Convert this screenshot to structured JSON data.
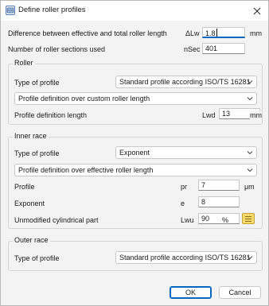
{
  "window": {
    "title": "Define roller profiles"
  },
  "general": {
    "diff_label": "Difference between effective and total roller length",
    "diff_symbol": "ΔLw",
    "diff_value": "1.8",
    "diff_unit": "mm",
    "nsec_label": "Number of roller sections used",
    "nsec_symbol": "nSec",
    "nsec_value": "401"
  },
  "roller": {
    "group_title": "Roller",
    "type_label": "Type of profile",
    "type_value": "Standard profile according ISO/TS 16281",
    "definition_value": "Profile definition over custom roller length",
    "length_label": "Profile definition length",
    "length_symbol": "Lwd",
    "length_value": "13",
    "length_unit": "mm"
  },
  "inner": {
    "group_title": "Inner race",
    "type_label": "Type of profile",
    "type_value": "Exponent",
    "definition_value": "Profile definition over effective roller length",
    "profile_label": "Profile",
    "profile_symbol": "pr",
    "profile_value": "7",
    "profile_unit": "μm",
    "exponent_label": "Exponent",
    "exponent_symbol": "e",
    "exponent_value": "8",
    "cyl_label": "Unmodified cylindrical part",
    "cyl_symbol": "Lwu",
    "cyl_value": "90",
    "cyl_unit": "%"
  },
  "outer": {
    "group_title": "Outer race",
    "type_label": "Type of profile",
    "type_value": "Standard profile according ISO/TS 16281"
  },
  "buttons": {
    "ok": "OK",
    "cancel": "Cancel"
  },
  "icons": {
    "app": "roller-profile-app-icon",
    "close": "close-icon",
    "dropdown": "chevron-down-icon",
    "side_button": "list-icon"
  },
  "colors": {
    "accent": "#0067c0",
    "side_button": "#f6d96a"
  }
}
